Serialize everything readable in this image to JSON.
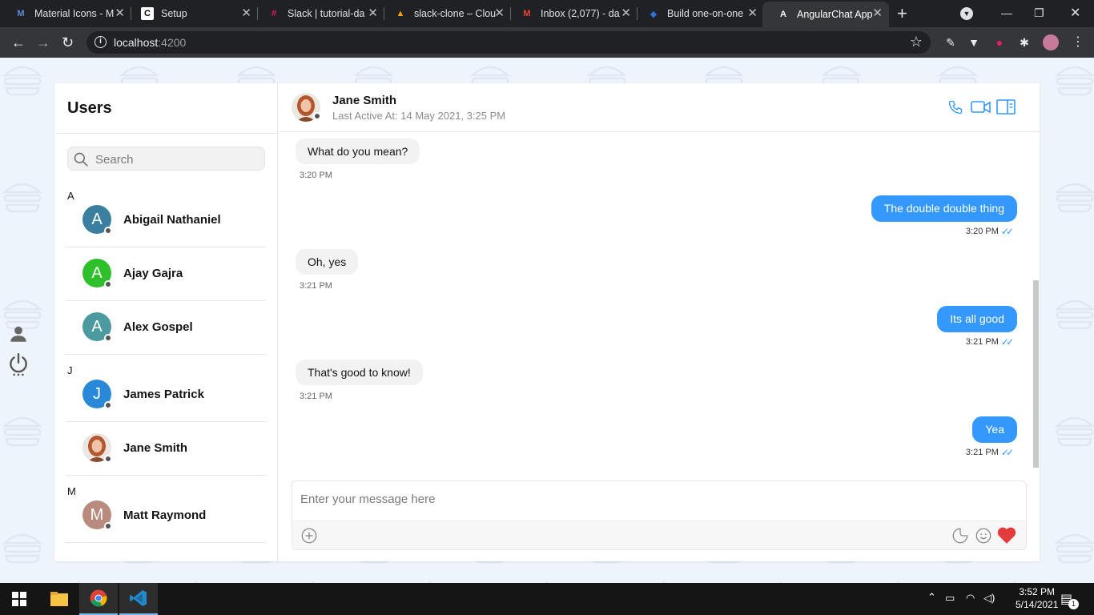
{
  "browser": {
    "tabs": [
      {
        "title": "Material Icons - M",
        "icon": "material-icons-favicon",
        "active": false
      },
      {
        "title": "Setup",
        "icon": "cometchat-favicon",
        "active": false
      },
      {
        "title": "Slack | tutorial-da",
        "icon": "slack-favicon",
        "active": false
      },
      {
        "title": "slack-clone – Clou",
        "icon": "firebase-favicon",
        "active": false
      },
      {
        "title": "Inbox (2,077) - da",
        "icon": "gmail-favicon",
        "active": false
      },
      {
        "title": "Build one-on-one",
        "icon": "build-favicon",
        "active": false
      },
      {
        "title": "AngularChat App",
        "icon": "angular-favicon",
        "active": true
      }
    ],
    "url_host": "localhost",
    "url_port": ":4200"
  },
  "sidebar": {
    "title": "Users",
    "search_placeholder": "Search",
    "groups": [
      {
        "letter": "A",
        "users": [
          {
            "name": "Abigail Nathaniel",
            "initial": "A",
            "color": "#3a7fa0"
          },
          {
            "name": "Ajay Gajra",
            "initial": "A",
            "color": "#2ec02a"
          },
          {
            "name": "Alex Gospel",
            "initial": "A",
            "color": "#4a9aa0"
          }
        ]
      },
      {
        "letter": "J",
        "users": [
          {
            "name": "James Patrick",
            "initial": "J",
            "color": "#2a88d8"
          },
          {
            "name": "Jane Smith",
            "initial": "",
            "color": "#c8856a"
          }
        ]
      },
      {
        "letter": "M",
        "users": [
          {
            "name": "Matt Raymond",
            "initial": "M",
            "color": "#b98a7e"
          }
        ]
      }
    ]
  },
  "chat": {
    "contact_name": "Jane Smith",
    "status": "Last Active At: 14 May 2021, 3:25 PM",
    "messages": [
      {
        "text": "What do you mean?",
        "time": "3:20 PM",
        "outgoing": false
      },
      {
        "text": "The double double thing",
        "time": "3:20 PM",
        "outgoing": true
      },
      {
        "text": "Oh, yes",
        "time": "3:21 PM",
        "outgoing": false
      },
      {
        "text": "Its all good",
        "time": "3:21 PM",
        "outgoing": true
      },
      {
        "text": "That's good to know!",
        "time": "3:21 PM",
        "outgoing": false
      },
      {
        "text": "Yea",
        "time": "3:21 PM",
        "outgoing": true
      }
    ],
    "composer_placeholder": "Enter your message here",
    "accent": "#3399ff"
  },
  "taskbar": {
    "time": "3:52 PM",
    "date": "5/14/2021",
    "notifications": "1"
  }
}
